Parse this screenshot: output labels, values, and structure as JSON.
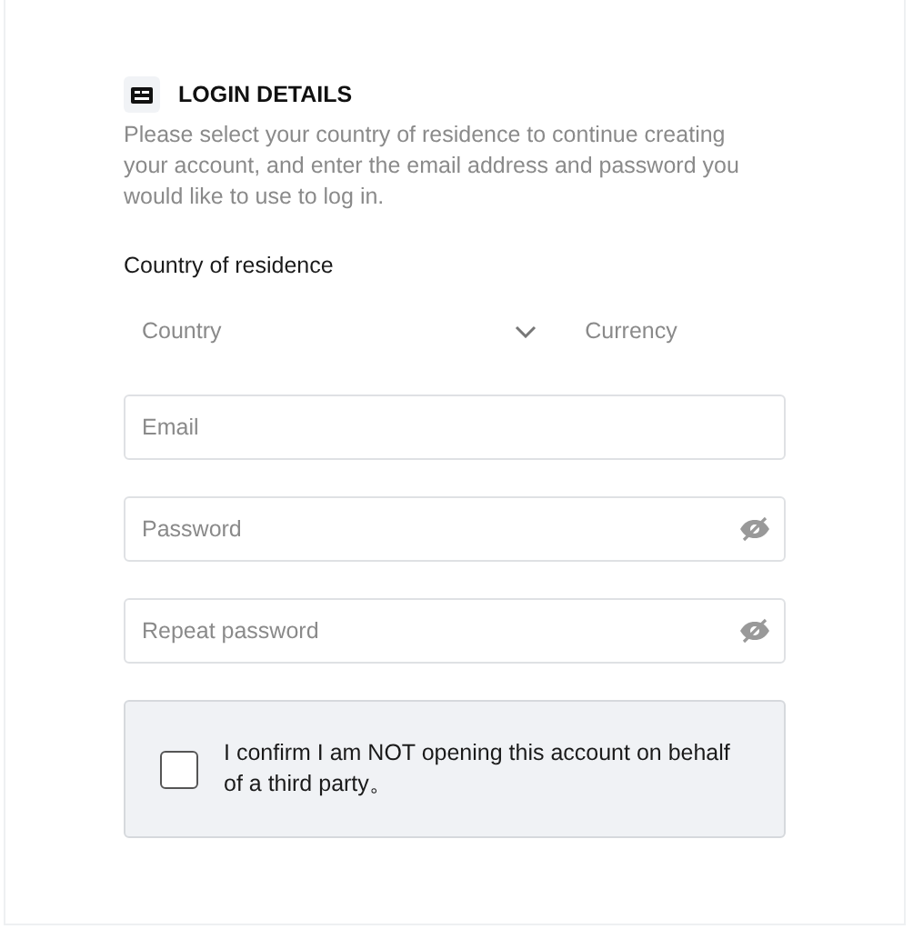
{
  "section": {
    "title": "LOGIN DETAILS",
    "description": "Please select your country of residence to continue creating your account, and enter the email address and password you would like to use to log in."
  },
  "country_label": "Country of residence",
  "selects": [
    {
      "kind": "dropdown",
      "placeholder": "Country"
    },
    {
      "kind": "plain",
      "placeholder": "Currency"
    }
  ],
  "fields": [
    {
      "kind": "text",
      "placeholder": "Email"
    },
    {
      "kind": "password",
      "placeholder": "Password"
    },
    {
      "kind": "password",
      "placeholder": "Repeat password"
    }
  ],
  "confirm": {
    "label": "I confirm I am NOT opening this account on behalf of a third party。",
    "checked": false
  }
}
